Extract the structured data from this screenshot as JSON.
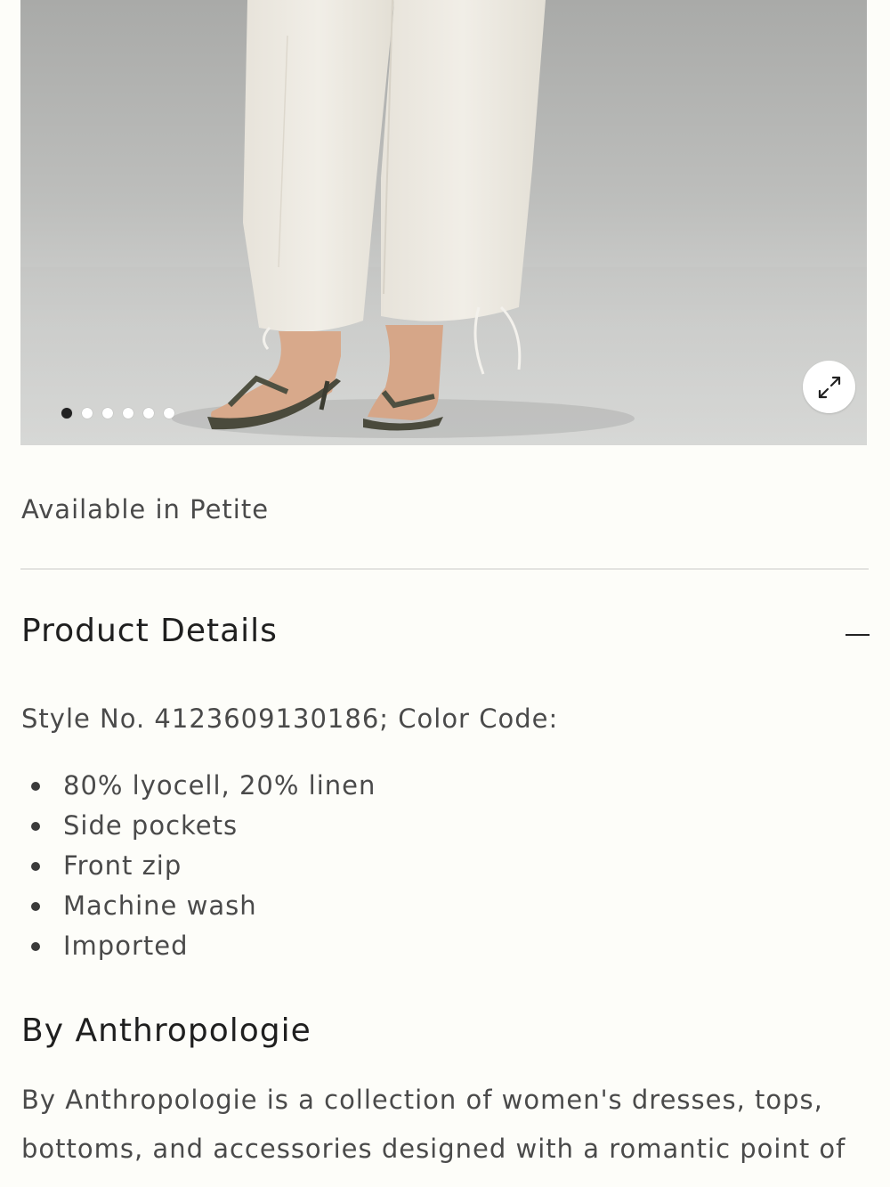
{
  "gallery": {
    "image_alt": "",
    "dots_count": 6,
    "active_index": 0
  },
  "availability": {
    "text": "Available in Petite"
  },
  "product_details": {
    "title": "Product Details",
    "style_line": "Style No. 4123609130186; Color Code:",
    "features": [
      "80% lyocell, 20% linen",
      "Side pockets",
      "Front zip",
      "Machine wash",
      "Imported"
    ]
  },
  "brand": {
    "title": "By Anthropologie",
    "description": "By Anthropologie is a collection of women's dresses, tops, bottoms, and accessories designed with a romantic point of"
  },
  "icons": {
    "expand": "expand-icon",
    "collapse": "minus-icon"
  },
  "colors": {
    "background": "#fdfdf9",
    "text": "#4a4a4a",
    "heading": "#1f1f1f"
  }
}
